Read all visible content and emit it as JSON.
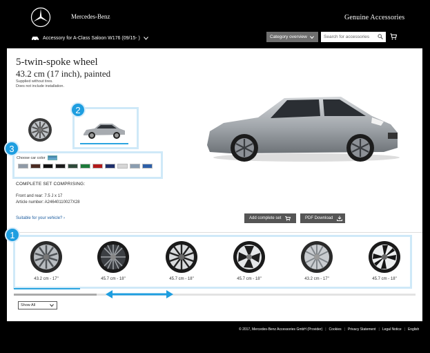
{
  "header": {
    "brand": "Mercedes-Benz",
    "section_title": "Genuine Accessories",
    "model_selector": "Accessory for A-Class Saloon W176 (09/15- )",
    "category_button": "Category overview",
    "search_placeholder": "Search for accessories"
  },
  "product": {
    "title": "5-twin-spoke wheel",
    "subtitle": "43.2 cm (17 inch), painted",
    "note1": "Supplied without tires.",
    "note2": "Does not include installation.",
    "color_label": "Choose car color",
    "set_heading": "COMPLETE SET COMPRISING:",
    "set_size": "Front and rear: 7.5 J x 17",
    "article": "Article number: A24640110027X28",
    "suitable_link": "Suitable for your vehicle?",
    "add_set_button": "Add complete set",
    "pdf_button": "PDF Download"
  },
  "callouts": [
    "1",
    "2",
    "3"
  ],
  "swatch_colors": [
    "#8f9aa6",
    "#4a2b22",
    "#111111",
    "#1b1b1b",
    "#2f4a3a",
    "#1d7a3a",
    "#b21a1a",
    "#1d2f6b",
    "#d6d6d6",
    "#8a9db0",
    "#2d5fa8"
  ],
  "wheels": [
    {
      "label": "43.2 cm - 17\""
    },
    {
      "label": "45.7 cm - 18\""
    },
    {
      "label": "45.7 cm - 18\""
    },
    {
      "label": "45.7 cm - 18\""
    },
    {
      "label": "43.2 cm - 17\""
    },
    {
      "label": "45.7 cm - 18\""
    }
  ],
  "filter": {
    "value": "Show All"
  },
  "footer": {
    "copyright": "© 2017, Mercedes-Benz Accessories GmbH (Provider)",
    "links": [
      "Cookies",
      "Privacy Statement",
      "Legal Notice",
      "English"
    ]
  },
  "colors": {
    "accent": "#1e9ee0",
    "panel": "#ffffff",
    "background": "#000000",
    "button_dark": "#555555"
  }
}
